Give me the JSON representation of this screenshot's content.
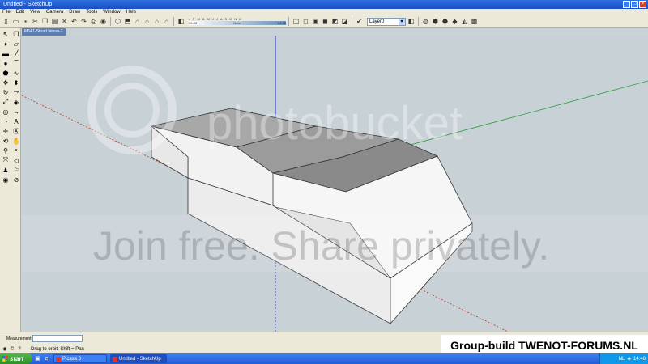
{
  "window": {
    "title": "Untitled - SketchUp",
    "controls": [
      "_",
      "□",
      "×"
    ]
  },
  "menu": [
    "File",
    "Edit",
    "View",
    "Camera",
    "Draw",
    "Tools",
    "Window",
    "Help"
  ],
  "toolbar": {
    "shadow_months": [
      "J",
      "F",
      "M",
      "A",
      "M",
      "J",
      "J",
      "A",
      "S",
      "O",
      "N",
      "D"
    ],
    "shadow_time_start": "06:43",
    "shadow_time_noon": "Noon",
    "shadow_time_end": "04:46",
    "layer_value": "Layer0"
  },
  "scene_tab": "M5A1-Stuart lateun-2",
  "watermark": {
    "brand": "photobucket",
    "tagline": "Join free. Share privately."
  },
  "status": {
    "measurements_label": "Measurements",
    "hint": "Drag to orbit.  Shift = Pan"
  },
  "caption": "Group-build TWENOT-FORUMS.NL",
  "taskbar": {
    "start": "start",
    "tasks": [
      {
        "label": "Picasa 3",
        "active": false
      },
      {
        "label": "Untitled - SketchUp",
        "active": true
      }
    ],
    "tray_lang": "NL",
    "clock": "14:48"
  },
  "colors": {
    "viewport_bg": "#c8d1d6",
    "axis_red": "#c0392b",
    "axis_green": "#2e9b3a",
    "axis_blue": "#1a2fd0",
    "top_face": "#9a9a9a",
    "side_face": "#f2f2f2"
  }
}
